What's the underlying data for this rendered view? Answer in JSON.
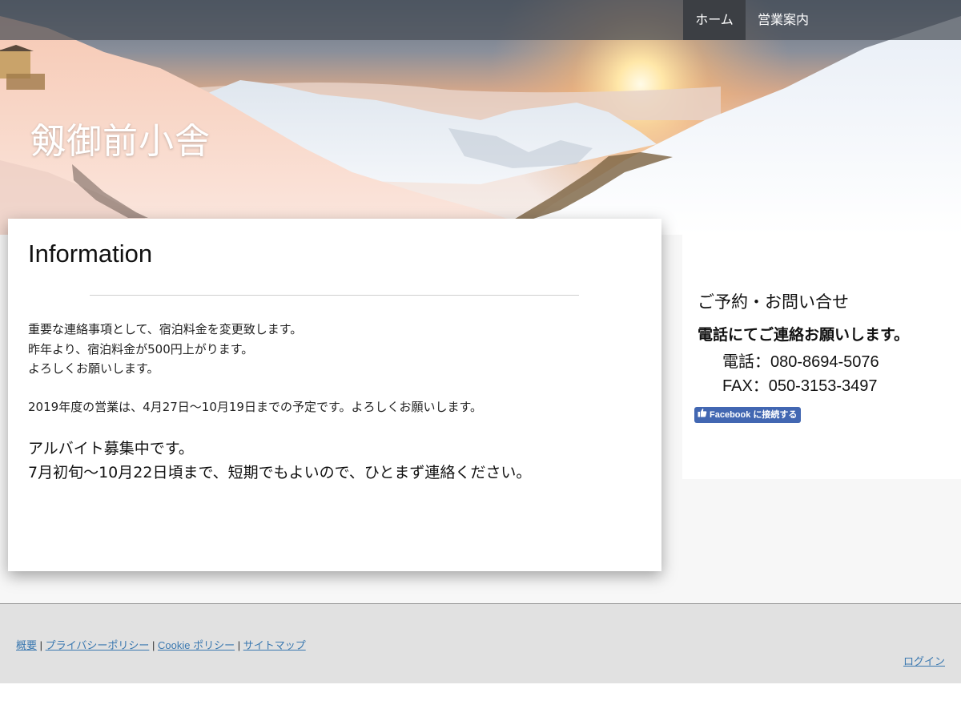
{
  "nav": {
    "home": "ホーム",
    "business": "営業案内"
  },
  "site": {
    "title": "剱御前小舎"
  },
  "main": {
    "heading": "Information",
    "para1": [
      "重要な連絡事項として、宿泊料金を変更致します。",
      "昨年より、宿泊料金が500円上がります。",
      "よろしくお願いします。"
    ],
    "para2": "2019年度の営業は、4月27日～10月19日までの予定です。よろしくお願いします。",
    "para3": [
      "アルバイト募集中です。",
      "7月初旬～10月22日頃まで、短期でもよいので、ひとまず連絡ください。"
    ]
  },
  "sidebar": {
    "heading": "ご予約・お問い合せ",
    "bold": "電話にてご連絡お願いします。",
    "phone": "電話：080-8694-5076",
    "fax": "FAX：050-3153-3497",
    "facebook_button": "Facebook に接続する"
  },
  "footer": {
    "links": [
      "概要",
      "プライバシーポリシー",
      "Cookie ポリシー",
      "サイトマップ"
    ],
    "separator": " | ",
    "login": "ログイン"
  },
  "colors": {
    "nav_active": "#3c3f44",
    "link": "#3a78b0",
    "facebook": "#4267b2"
  }
}
